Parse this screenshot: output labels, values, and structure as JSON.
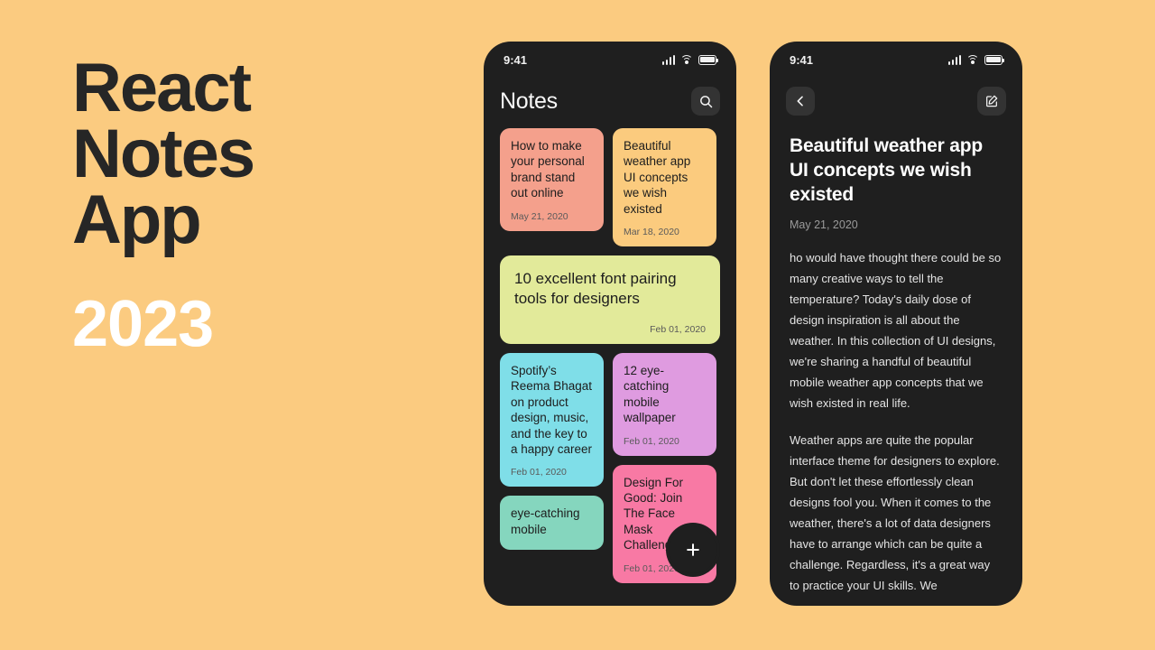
{
  "promo": {
    "title_lines": [
      "React",
      "Notes",
      "App"
    ],
    "year": "2023",
    "title_color": "#262626",
    "year_color": "#ffffff",
    "background_color": "#FBCB80"
  },
  "phone_list": {
    "status_bar": {
      "time": "9:41",
      "signal_icon": "signal-bars-icon",
      "wifi_icon": "wifi-icon",
      "battery_icon": "battery-icon"
    },
    "appbar": {
      "title": "Notes",
      "search_icon": "search-icon"
    },
    "fab": {
      "icon": "plus-icon",
      "background_color": "#1f1f1f"
    },
    "notes": [
      {
        "title": "How to make your personal brand stand out online",
        "date": "May 21, 2020",
        "color": "#F4A08C",
        "column": "left"
      },
      {
        "title": "Beautiful weather app UI concepts we wish existed",
        "date": "Mar 18, 2020",
        "color": "#FBCB7E",
        "column": "right"
      },
      {
        "title": "10 excellent font pairing tools for designers",
        "date": "Feb 01, 2020",
        "color": "#E2EA9A",
        "column": "wide"
      },
      {
        "title": "Spotify’s Reema Bhagat on product design, music, and the key to a happy career",
        "date": "Feb 01, 2020",
        "color": "#7FDEE8",
        "column": "left"
      },
      {
        "title": "12 eye-catching mobile wallpaper",
        "date": "Feb 01, 2020",
        "color": "#DF9BE0",
        "column": "right"
      },
      {
        "title": "Design For Good: Join The Face Mask Challenge",
        "date": "Feb 01, 2020",
        "color": "#F879A4",
        "column": "right"
      },
      {
        "title": "eye-catching mobile",
        "date": "",
        "color": "#85D6BE",
        "column": "left"
      }
    ]
  },
  "phone_detail": {
    "status_bar": {
      "time": "9:41",
      "signal_icon": "signal-bars-icon",
      "wifi_icon": "wifi-icon",
      "battery_icon": "battery-icon"
    },
    "appbar": {
      "back_icon": "chevron-left-icon",
      "edit_icon": "edit-pencil-icon"
    },
    "note": {
      "title": "Beautiful weather app UI concepts we wish existed",
      "date": "May 21, 2020",
      "paragraph_1": "ho would have thought there could be so many creative ways to tell the temperature? Today's daily dose of design inspiration is all about the weather. In this collection of UI designs, we're sharing a handful of beautiful mobile weather app concepts that we wish existed in real life.",
      "paragraph_2": "Weather apps are quite the popular interface theme for designers to explore. But don't let these effortlessly clean designs fool you. When it comes to the weather, there's a lot of data designers have to arrange which can be quite a challenge. Regardless, it's a great way to practice your UI skills. We"
    }
  }
}
